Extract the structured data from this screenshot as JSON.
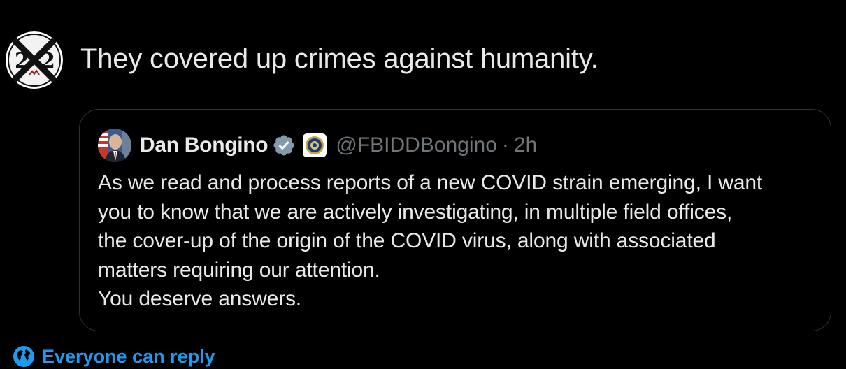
{
  "post": {
    "text": "They covered up crimes against humanity."
  },
  "quote": {
    "name": "Dan Bongino",
    "handle": "@FBIDDBongino",
    "separator": "·",
    "time": "2h",
    "lines": [
      "As we read and process reports of a new COVID strain emerging, I want",
      "you to know that we are actively investigating, in multiple field offices,",
      "the cover-up of the origin of the COVID virus, along with associated",
      "matters requiring our attention.",
      "You deserve answers."
    ]
  },
  "reply_setting": {
    "label": "Everyone can reply",
    "icon": "globe-icon"
  },
  "colors": {
    "background": "#000000",
    "text": "#e7e9ea",
    "muted": "#71767b",
    "accent": "#1d9bf0",
    "border": "#2f3336",
    "verified_gray": "#829aab"
  }
}
